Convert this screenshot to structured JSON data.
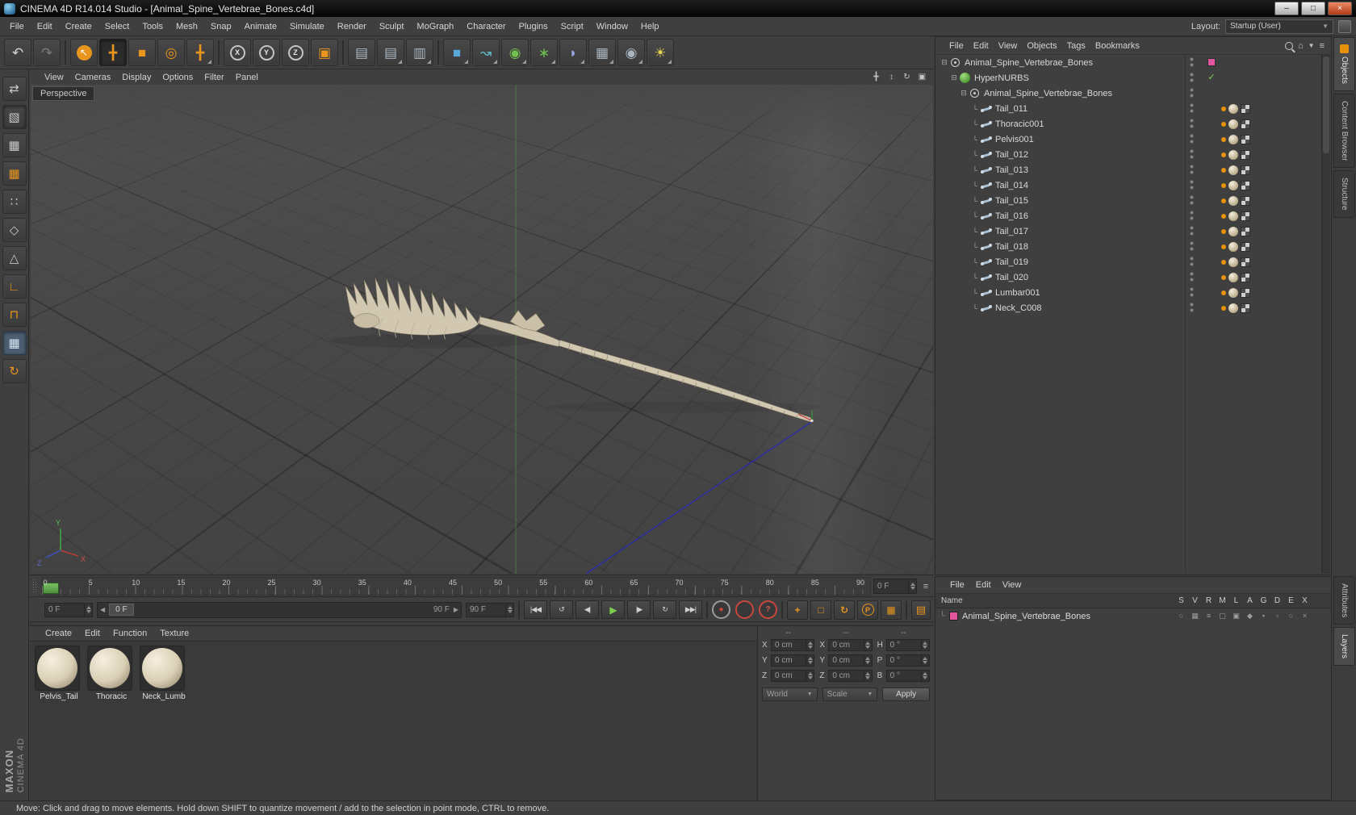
{
  "window": {
    "title": "CINEMA 4D R14.014 Studio - [Animal_Spine_Vertebrae_Bones.c4d]",
    "controls": [
      {
        "name": "minimize-button",
        "glyph": "–"
      },
      {
        "name": "maximize-button",
        "glyph": "□"
      },
      {
        "name": "close-button",
        "glyph": "×",
        "cls": "close"
      }
    ]
  },
  "menu_bar": {
    "items": [
      "File",
      "Edit",
      "Create",
      "Select",
      "Tools",
      "Mesh",
      "Snap",
      "Animate",
      "Simulate",
      "Render",
      "Sculpt",
      "MoGraph",
      "Character",
      "Plugins",
      "Script",
      "Window",
      "Help"
    ],
    "layout_label": "Layout:",
    "layout_value": "Startup (User)"
  },
  "toolbar": {
    "buttons": [
      {
        "name": "undo-button",
        "glyph": "↶",
        "cls": "light"
      },
      {
        "name": "redo-button",
        "glyph": "↷",
        "cls": "dim"
      },
      {
        "name": "separator",
        "cls": "sep"
      },
      {
        "name": "live-selection-tool",
        "glyph": "↖",
        "cls": "sel"
      },
      {
        "name": "move-tool",
        "glyph": "╋",
        "cls": "orange",
        "active": true
      },
      {
        "name": "scale-tool",
        "glyph": "■",
        "cls": "orange"
      },
      {
        "name": "rotate-tool",
        "glyph": "◎",
        "cls": "orange"
      },
      {
        "name": "last-used-tool",
        "glyph": "╋",
        "cls": "orange",
        "dd": true
      },
      {
        "name": "separator",
        "cls": "sep"
      },
      {
        "name": "lock-x-button",
        "glyph": "X",
        "cls": "ring"
      },
      {
        "name": "lock-y-button",
        "glyph": "Y",
        "cls": "ring"
      },
      {
        "name": "lock-z-button",
        "glyph": "Z",
        "cls": "ring"
      },
      {
        "name": "coord-system-button",
        "glyph": "▣",
        "cls": "orange"
      },
      {
        "name": "separator",
        "cls": "sep"
      },
      {
        "name": "render-view-button",
        "glyph": "▤",
        "cls": "steel"
      },
      {
        "name": "render-picture-viewer-button",
        "glyph": "▤",
        "cls": "steel",
        "dd": true
      },
      {
        "name": "render-settings-button",
        "glyph": "▥",
        "cls": "steel",
        "dd": true
      },
      {
        "name": "separator",
        "cls": "sep"
      },
      {
        "name": "add-cube-button",
        "glyph": "■",
        "cls": "blue",
        "dd": true
      },
      {
        "name": "spline-pen-button",
        "glyph": "↝",
        "cls": "teal",
        "dd": true
      },
      {
        "name": "subdivision-surface-button",
        "glyph": "◉",
        "cls": "green",
        "dd": true
      },
      {
        "name": "modeling-objects-button",
        "glyph": "∗",
        "cls": "green",
        "dd": true
      },
      {
        "name": "deformer-objects-button",
        "glyph": "◗",
        "cls": "violet",
        "dd": true
      },
      {
        "name": "scene-objects-button",
        "glyph": "▦",
        "cls": "steel",
        "dd": true
      },
      {
        "name": "camera-objects-button",
        "glyph": "◉",
        "cls": "steel",
        "dd": true
      },
      {
        "name": "light-objects-button",
        "glyph": "☀",
        "cls": "yellow",
        "dd": true
      }
    ]
  },
  "side_toolbar": {
    "buttons": [
      {
        "name": "make-editable-button",
        "glyph": "⇄",
        "cls": "light"
      },
      {
        "name": "model-mode-button",
        "glyph": "▧",
        "cls": "light",
        "active": true
      },
      {
        "name": "texture-mode-button",
        "glyph": "▦",
        "cls": "light"
      },
      {
        "name": "workplane-mode-button",
        "glyph": "▦",
        "cls": "orange"
      },
      {
        "name": "points-mode-button",
        "glyph": "∷",
        "cls": "light"
      },
      {
        "name": "edges-mode-button",
        "glyph": "◇",
        "cls": "light"
      },
      {
        "name": "polygons-mode-button",
        "glyph": "△",
        "cls": "light"
      },
      {
        "name": "axis-mode-button",
        "glyph": "∟",
        "cls": "orange"
      },
      {
        "name": "snap-toggle-button",
        "glyph": "⊓",
        "cls": "orange"
      },
      {
        "name": "texture-axis-mode-button",
        "glyph": "▦",
        "cls": "bluesel",
        "active": true
      },
      {
        "name": "workplane-snap-button",
        "glyph": "↻",
        "cls": "orange"
      }
    ]
  },
  "branding": {
    "line1": "MAXON",
    "line2": "CINEMA 4D"
  },
  "viewport": {
    "label": "Perspective",
    "menus": [
      "View",
      "Cameras",
      "Display",
      "Options",
      "Filter",
      "Panel"
    ],
    "nav": [
      {
        "name": "pan-view-icon",
        "glyph": "╋"
      },
      {
        "name": "dolly-view-icon",
        "glyph": "↕"
      },
      {
        "name": "rotate-view-icon",
        "glyph": "↻"
      },
      {
        "name": "toggle-view-icon",
        "glyph": "▣"
      }
    ],
    "axis": {
      "x": "X",
      "y": "Y",
      "z": "Z"
    }
  },
  "timeline": {
    "labels": [
      "0",
      "5",
      "10",
      "15",
      "20",
      "25",
      "30",
      "35",
      "40",
      "45",
      "50",
      "55",
      "60",
      "65",
      "70",
      "75",
      "80",
      "85",
      "90"
    ],
    "frame_field": "0 F"
  },
  "transport": {
    "current_field": "0 F",
    "slider_current": "0 F",
    "slider_end": "90 F",
    "end_field": "90 F",
    "buttons": [
      {
        "name": "goto-start-button",
        "glyph": "|◀◀"
      },
      {
        "name": "play-backwards-button",
        "glyph": "↺"
      },
      {
        "name": "prev-frame-button",
        "glyph": "◀|"
      },
      {
        "name": "play-button",
        "glyph": "▶",
        "cls": "green"
      },
      {
        "name": "next-frame-button",
        "glyph": "|▶"
      },
      {
        "name": "play-forwards-button",
        "glyph": "↻"
      },
      {
        "name": "goto-end-button",
        "glyph": "▶▶|"
      }
    ],
    "record": [
      {
        "name": "record-keyframe-button",
        "glyph": "●",
        "cls": "record"
      },
      {
        "name": "autokey-button",
        "glyph": "",
        "cls": "autokey"
      },
      {
        "name": "keyframe-selection-button",
        "glyph": "?",
        "cls": "help"
      }
    ],
    "keylocks": [
      {
        "name": "key-position-button",
        "glyph": "+"
      },
      {
        "name": "key-scale-button",
        "glyph": "□"
      },
      {
        "name": "key-rotation-button",
        "glyph": "↻"
      },
      {
        "name": "key-parameter-button",
        "glyph": "P",
        "cls": "circ"
      },
      {
        "name": "key-pla-button",
        "glyph": "▦"
      }
    ],
    "options": {
      "name": "animation-palette-icon",
      "glyph": "▤"
    }
  },
  "materials": {
    "menus": [
      "Create",
      "Edit",
      "Function",
      "Texture"
    ],
    "items": [
      {
        "name": "Pelvis_Tail"
      },
      {
        "name": "Thoracic"
      },
      {
        "name": "Neck_Lumb"
      }
    ]
  },
  "coordinates": {
    "groups": [
      {
        "header": "--",
        "rows": [
          {
            "label": "X",
            "value": "0 cm"
          },
          {
            "label": "Y",
            "value": "0 cm"
          },
          {
            "label": "Z",
            "value": "0 cm"
          }
        ]
      },
      {
        "header": "--",
        "rows": [
          {
            "label": "X",
            "value": "0 cm"
          },
          {
            "label": "Y",
            "value": "0 cm"
          },
          {
            "label": "Z",
            "value": "0 cm"
          }
        ]
      },
      {
        "header": "--",
        "rows": [
          {
            "label": "H",
            "value": "0 °"
          },
          {
            "label": "P",
            "value": "0 °"
          },
          {
            "label": "B",
            "value": "0 °"
          }
        ]
      }
    ],
    "world_dropdown": "World",
    "scale_dropdown": "Scale",
    "apply_button": "Apply"
  },
  "object_manager": {
    "menus": [
      "File",
      "Edit",
      "View",
      "Objects",
      "Tags",
      "Bookmarks"
    ],
    "icons": {
      "home": "⌂",
      "filter": "▼",
      "menu": "≡"
    },
    "tree": [
      {
        "label": "Animal_Spine_Vertebrae_Bones",
        "level": 0,
        "icon": "null",
        "expander": "⊟",
        "tag": "pink"
      },
      {
        "label": "HyperNURBS",
        "level": 1,
        "icon": "hypernurbs",
        "expander": "⊟",
        "tag": "check"
      },
      {
        "label": "Animal_Spine_Vertebrae_Bones",
        "level": 2,
        "icon": "null",
        "expander": "⊟",
        "tag": "none"
      },
      {
        "label": "Tail_011",
        "level": 3,
        "icon": "joint",
        "expander": "└",
        "tag": "material"
      },
      {
        "label": "Thoracic001",
        "level": 3,
        "icon": "joint",
        "expander": "└",
        "tag": "material"
      },
      {
        "label": "Pelvis001",
        "level": 3,
        "icon": "joint",
        "expander": "└",
        "tag": "material"
      },
      {
        "label": "Tail_012",
        "level": 3,
        "icon": "joint",
        "expander": "└",
        "tag": "material"
      },
      {
        "label": "Tail_013",
        "level": 3,
        "icon": "joint",
        "expander": "└",
        "tag": "material"
      },
      {
        "label": "Tail_014",
        "level": 3,
        "icon": "joint",
        "expander": "└",
        "tag": "material"
      },
      {
        "label": "Tail_015",
        "level": 3,
        "icon": "joint",
        "expander": "└",
        "tag": "material"
      },
      {
        "label": "Tail_016",
        "level": 3,
        "icon": "joint",
        "expander": "└",
        "tag": "material"
      },
      {
        "label": "Tail_017",
        "level": 3,
        "icon": "joint",
        "expander": "└",
        "tag": "material"
      },
      {
        "label": "Tail_018",
        "level": 3,
        "icon": "joint",
        "expander": "└",
        "tag": "material"
      },
      {
        "label": "Tail_019",
        "level": 3,
        "icon": "joint",
        "expander": "└",
        "tag": "material"
      },
      {
        "label": "Tail_020",
        "level": 3,
        "icon": "joint",
        "expander": "└",
        "tag": "material"
      },
      {
        "label": "Lumbar001",
        "level": 3,
        "icon": "joint",
        "expander": "└",
        "tag": "material"
      },
      {
        "label": "Neck_C008",
        "level": 3,
        "icon": "joint",
        "expander": "└",
        "tag": "material"
      }
    ]
  },
  "right_tabs": {
    "top": [
      {
        "label": "Objects",
        "active": true,
        "icon": "grid-orange"
      },
      {
        "label": "Content Browser"
      },
      {
        "label": "Structure"
      }
    ],
    "bottom": [
      {
        "label": "Attributes"
      },
      {
        "label": "Layers",
        "active": true
      }
    ]
  },
  "layer_panel": {
    "menus": [
      "File",
      "Edit",
      "View"
    ],
    "name_header": "Name",
    "columns": [
      "S",
      "V",
      "R",
      "M",
      "L",
      "A",
      "G",
      "D",
      "E",
      "X"
    ],
    "row": {
      "label": "Animal_Spine_Vertebrae_Bones",
      "toggles": [
        "○",
        "▦",
        "≡",
        "▢",
        "▣",
        "◆",
        "▪",
        "▫",
        "○",
        "×"
      ]
    }
  },
  "status_bar": {
    "text": "Move: Click and drag to move elements. Hold down SHIFT to quantize movement / add to the selection in point mode, CTRL to remove."
  }
}
